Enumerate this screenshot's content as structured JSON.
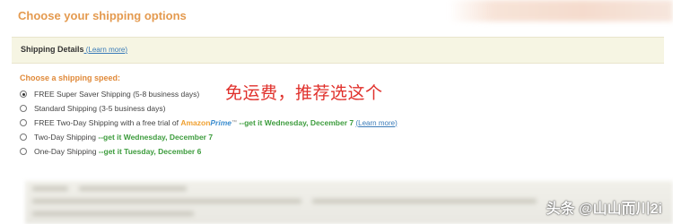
{
  "page": {
    "title": "Choose your shipping options"
  },
  "details": {
    "title": "Shipping Details",
    "link_paren_open": " (",
    "link": "Learn more",
    "link_paren_close": ")"
  },
  "shipping": {
    "heading": "Choose a shipping speed:",
    "selected_index": 0,
    "options": [
      {
        "label": "FREE Super Saver Shipping (5-8 business days)"
      },
      {
        "label": "Standard Shipping (3-5 business days)"
      },
      {
        "label_prefix": "FREE Two-Day Shipping with a free trial of ",
        "amazon": "Amazon",
        "prime": "Prime",
        "tm": "™",
        "separator": " --",
        "get_it": "get it Wednesday, December 7",
        "link_paren_open": " (",
        "link": "Learn more",
        "link_paren_close": ")"
      },
      {
        "label": "Two-Day Shipping",
        "separator": " --",
        "get_it": "get it Wednesday, December 7"
      },
      {
        "label": "One-Day Shipping",
        "separator": " --",
        "get_it": "get it Tuesday, December 6"
      }
    ]
  },
  "annotation": {
    "text": "免运费，推荐选这个",
    "color": "#e0302b"
  },
  "watermark": {
    "text": "头条 @山山而川2i"
  },
  "colors": {
    "title_orange": "#e49a4f",
    "link_blue": "#3a7bb8",
    "delivery_green": "#3d9c3d",
    "details_bg": "#f6f5e3"
  }
}
